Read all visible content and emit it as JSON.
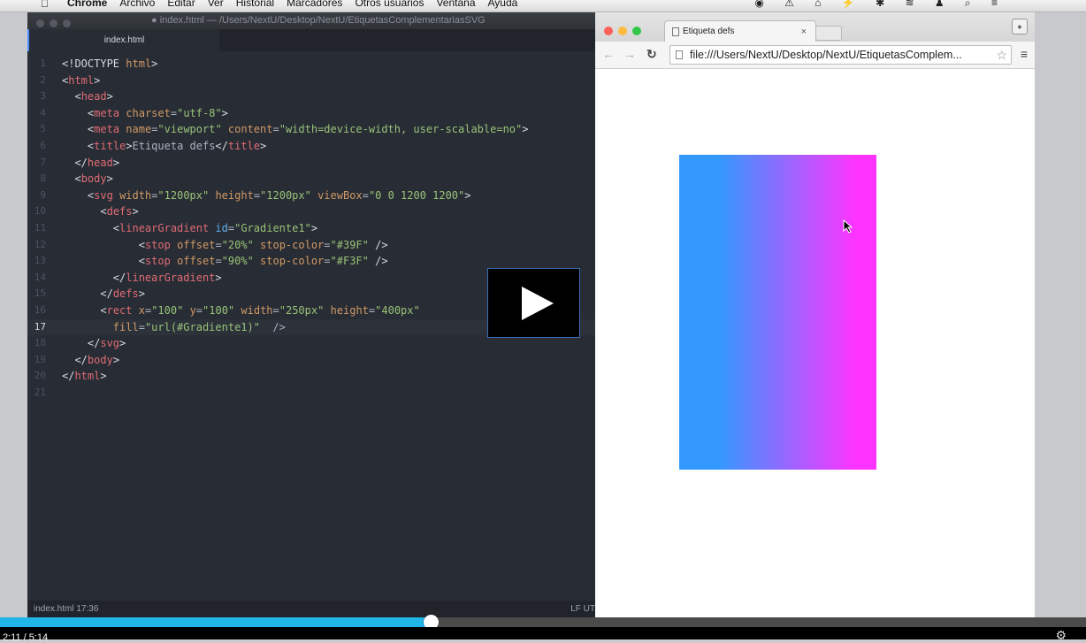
{
  "menubar": {
    "apple": "",
    "items": [
      "Chrome",
      "Archivo",
      "Editar",
      "Ver",
      "Historial",
      "Marcadores",
      "Otros usuarios",
      "Ventana",
      "Ayuda"
    ],
    "tray": "◉ ⚠ ⌂ ⚡ ✱ ≋ ♟ ⌕ ≡"
  },
  "editor": {
    "window_title": "● index.html — /Users/NextU/Desktop/NextU/EtiquetasComplementariasSVG",
    "tab_label": "index.html",
    "status_left": "index.html   17:36",
    "status_right": "LF  UT",
    "lines": [
      {
        "n": "1",
        "c": "<!DOCTYPE html>"
      },
      {
        "n": "2",
        "c": "<html>"
      },
      {
        "n": "3",
        "c": "  <head>"
      },
      {
        "n": "4",
        "c": "    <meta charset=\"utf-8\">"
      },
      {
        "n": "5",
        "c": "    <meta name=\"viewport\" content=\"width=device-width, user-scalable=no\">"
      },
      {
        "n": "6",
        "c": "    <title>Etiqueta defs</title>"
      },
      {
        "n": "7",
        "c": "  </head>"
      },
      {
        "n": "8",
        "c": "  <body>"
      },
      {
        "n": "9",
        "c": "    <svg width=\"1200px\" height=\"1200px\" viewBox=\"0 0 1200 1200\">"
      },
      {
        "n": "10",
        "c": "      <defs>"
      },
      {
        "n": "11",
        "c": "        <linearGradient id=\"Gradiente1\">"
      },
      {
        "n": "12",
        "c": "            <stop offset=\"20%\" stop-color=\"#39F\" />"
      },
      {
        "n": "13",
        "c": "            <stop offset=\"90%\" stop-color=\"#F3F\" />"
      },
      {
        "n": "14",
        "c": "        </linearGradient>"
      },
      {
        "n": "15",
        "c": "      </defs>"
      },
      {
        "n": "16",
        "c": "      <rect x=\"100\" y=\"100\" width=\"250px\" height=\"400px\""
      },
      {
        "n": "17",
        "c": "        fill=\"url(#Gradiente1)\"  />"
      },
      {
        "n": "18",
        "c": "    </svg>"
      },
      {
        "n": "19",
        "c": "  </body>"
      },
      {
        "n": "20",
        "c": "</html>"
      },
      {
        "n": "21",
        "c": ""
      }
    ],
    "current_line": "17"
  },
  "browser": {
    "tab_title": "Etiqueta defs",
    "tab_close": "×",
    "url": "file:///Users/NextU/Desktop/NextU/EtiquetasComplem...",
    "gradient": {
      "color_start": "#3399ff",
      "offset_start": "20%",
      "color_end": "#ff33ff",
      "offset_end": "90%"
    }
  },
  "video": {
    "time": "2:11 / 5:14",
    "progress_fraction": 0.397
  },
  "colors": {
    "editor_bg": "#282c34",
    "progress": "#21b6e8"
  }
}
